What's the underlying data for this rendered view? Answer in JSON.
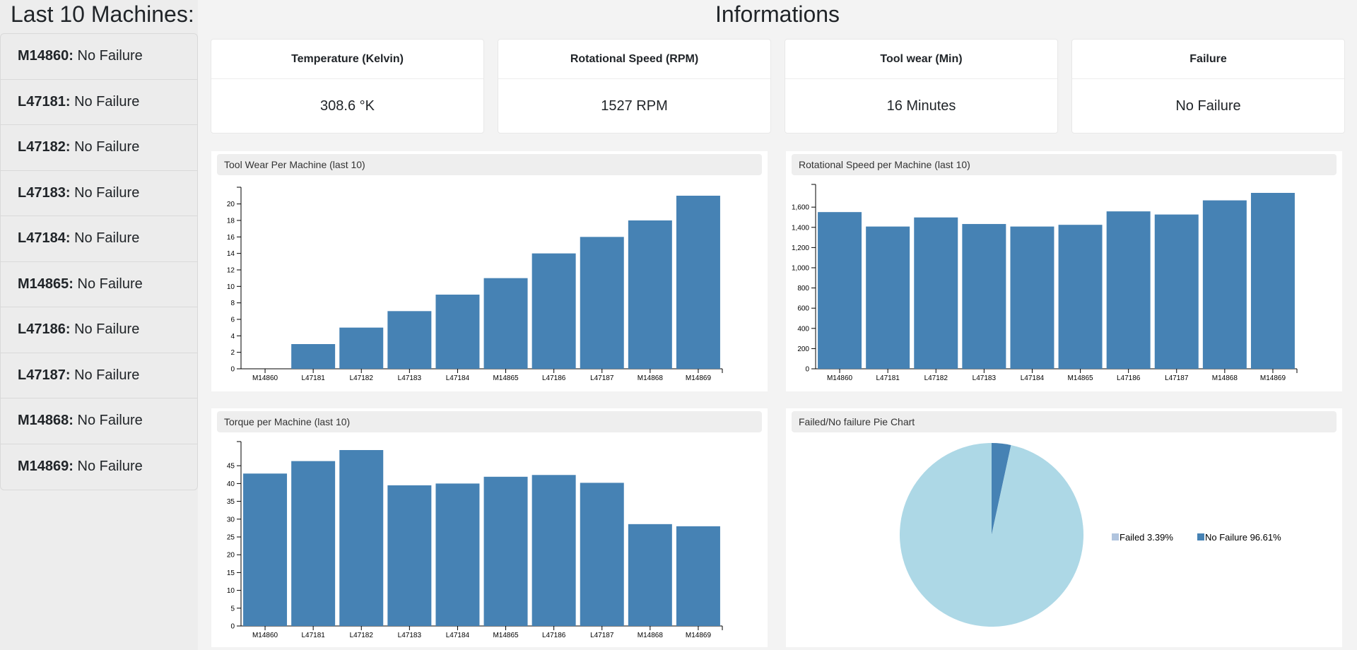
{
  "sidebar": {
    "title": "Last 10 Machines:",
    "machines": [
      {
        "id": "M14860:",
        "status": "No Failure"
      },
      {
        "id": "L47181:",
        "status": "No Failure"
      },
      {
        "id": "L47182:",
        "status": "No Failure"
      },
      {
        "id": "L47183:",
        "status": "No Failure"
      },
      {
        "id": "L47184:",
        "status": "No Failure"
      },
      {
        "id": "M14865:",
        "status": "No Failure"
      },
      {
        "id": "L47186:",
        "status": "No Failure"
      },
      {
        "id": "L47187:",
        "status": "No Failure"
      },
      {
        "id": "M14868:",
        "status": "No Failure"
      },
      {
        "id": "M14869:",
        "status": "No Failure"
      }
    ]
  },
  "main": {
    "title": "Informations",
    "cards": [
      {
        "header": "Temperature (Kelvin)",
        "value": "308.6 °K"
      },
      {
        "header": "Rotational Speed (RPM)",
        "value": "1527 RPM"
      },
      {
        "header": "Tool wear (Min)",
        "value": "16 Minutes"
      },
      {
        "header": "Failure",
        "value": "No Failure"
      }
    ],
    "panels": {
      "toolwear": "Tool Wear Per Machine (last 10)",
      "rotational": "Rotational Speed per Machine (last 10)",
      "torque": "Torque per Machine (last 10)",
      "pie": "Failed/No failure Pie Chart"
    }
  },
  "colors": {
    "bar": "#4682b4",
    "pie_failed": "#4682b4",
    "pie_nofailure": "#add8e6",
    "legend_failed": "#b0c4de",
    "legend_nofailure": "#4682b4"
  },
  "chart_data": [
    {
      "type": "bar",
      "title": "Tool Wear Per Machine (last 10)",
      "categories": [
        "M14860",
        "L47181",
        "L47182",
        "L47183",
        "L47184",
        "M14865",
        "L47186",
        "L47187",
        "M14868",
        "M14869"
      ],
      "values": [
        0,
        3,
        5,
        7,
        9,
        11,
        14,
        16,
        18,
        21
      ],
      "yticks": [
        0,
        2,
        4,
        6,
        8,
        10,
        12,
        14,
        16,
        18,
        20
      ],
      "ylim": [
        0,
        21
      ]
    },
    {
      "type": "bar",
      "title": "Rotational Speed per Machine (last 10)",
      "categories": [
        "M14860",
        "L47181",
        "L47182",
        "L47183",
        "L47184",
        "M14865",
        "L47186",
        "L47187",
        "M14868",
        "M14869"
      ],
      "values": [
        1551,
        1408,
        1498,
        1433,
        1408,
        1425,
        1558,
        1527,
        1667,
        1741
      ],
      "yticks": [
        0,
        200,
        400,
        600,
        800,
        1000,
        1200,
        1400,
        1600
      ],
      "yticklabels": [
        "0",
        "200",
        "400",
        "600",
        "800",
        "1,000",
        "1,200",
        "1,400",
        "1,600"
      ],
      "ylim": [
        0,
        1741
      ]
    },
    {
      "type": "bar",
      "title": "Torque per Machine (last 10)",
      "categories": [
        "M14860",
        "L47181",
        "L47182",
        "L47183",
        "L47184",
        "M14865",
        "L47186",
        "L47187",
        "M14868",
        "M14869"
      ],
      "values": [
        42.8,
        46.3,
        49.4,
        39.5,
        40.0,
        41.9,
        42.4,
        40.2,
        28.6,
        28.0
      ],
      "yticks": [
        0,
        5,
        10,
        15,
        20,
        25,
        30,
        35,
        40,
        45
      ],
      "ylim": [
        0,
        49.4
      ]
    },
    {
      "type": "pie",
      "title": "Failed/No failure Pie Chart",
      "slices": [
        {
          "label": "Failed",
          "value": 3.39,
          "legend": "Failed 3.39%"
        },
        {
          "label": "No Failure",
          "value": 96.61,
          "legend": "No Failure 96.61%"
        }
      ]
    }
  ]
}
